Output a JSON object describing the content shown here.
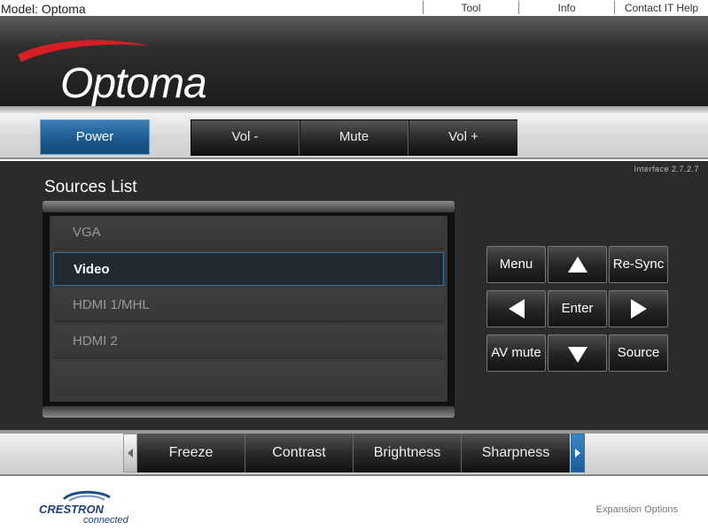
{
  "topbar": {
    "model": "Model: Optoma",
    "links": [
      "Tool",
      "Info",
      "Contact IT Help"
    ]
  },
  "header": {
    "logo_text": "Optoma",
    "brand_color": "#d61f26"
  },
  "controls": {
    "power": "Power",
    "volume": [
      "Vol -",
      "Mute",
      "Vol +"
    ]
  },
  "interface_version": "Interface 2.7.2.7",
  "sources": {
    "title": "Sources List",
    "items": [
      "VGA",
      "Video",
      "HDMI 1/MHL",
      "HDMI 2"
    ],
    "selected": "Video"
  },
  "keypad": {
    "menu": "Menu",
    "resync": "Re-Sync",
    "enter": "Enter",
    "avmute": "AV mute",
    "source": "Source",
    "icons": [
      "up-arrow-icon",
      "left-arrow-icon",
      "right-arrow-icon",
      "down-arrow-icon"
    ]
  },
  "functions": {
    "items": [
      "Freeze",
      "Contrast",
      "Brightness",
      "Sharpness"
    ],
    "icons": [
      "scroll-left-icon",
      "scroll-right-icon"
    ]
  },
  "footer": {
    "logo_text": "CRESTRON",
    "logo_sub": "connected",
    "expansion": "Expansion Options"
  },
  "colors": {
    "accent": "#1c5a8f",
    "selected_border": "#3d6f94"
  }
}
